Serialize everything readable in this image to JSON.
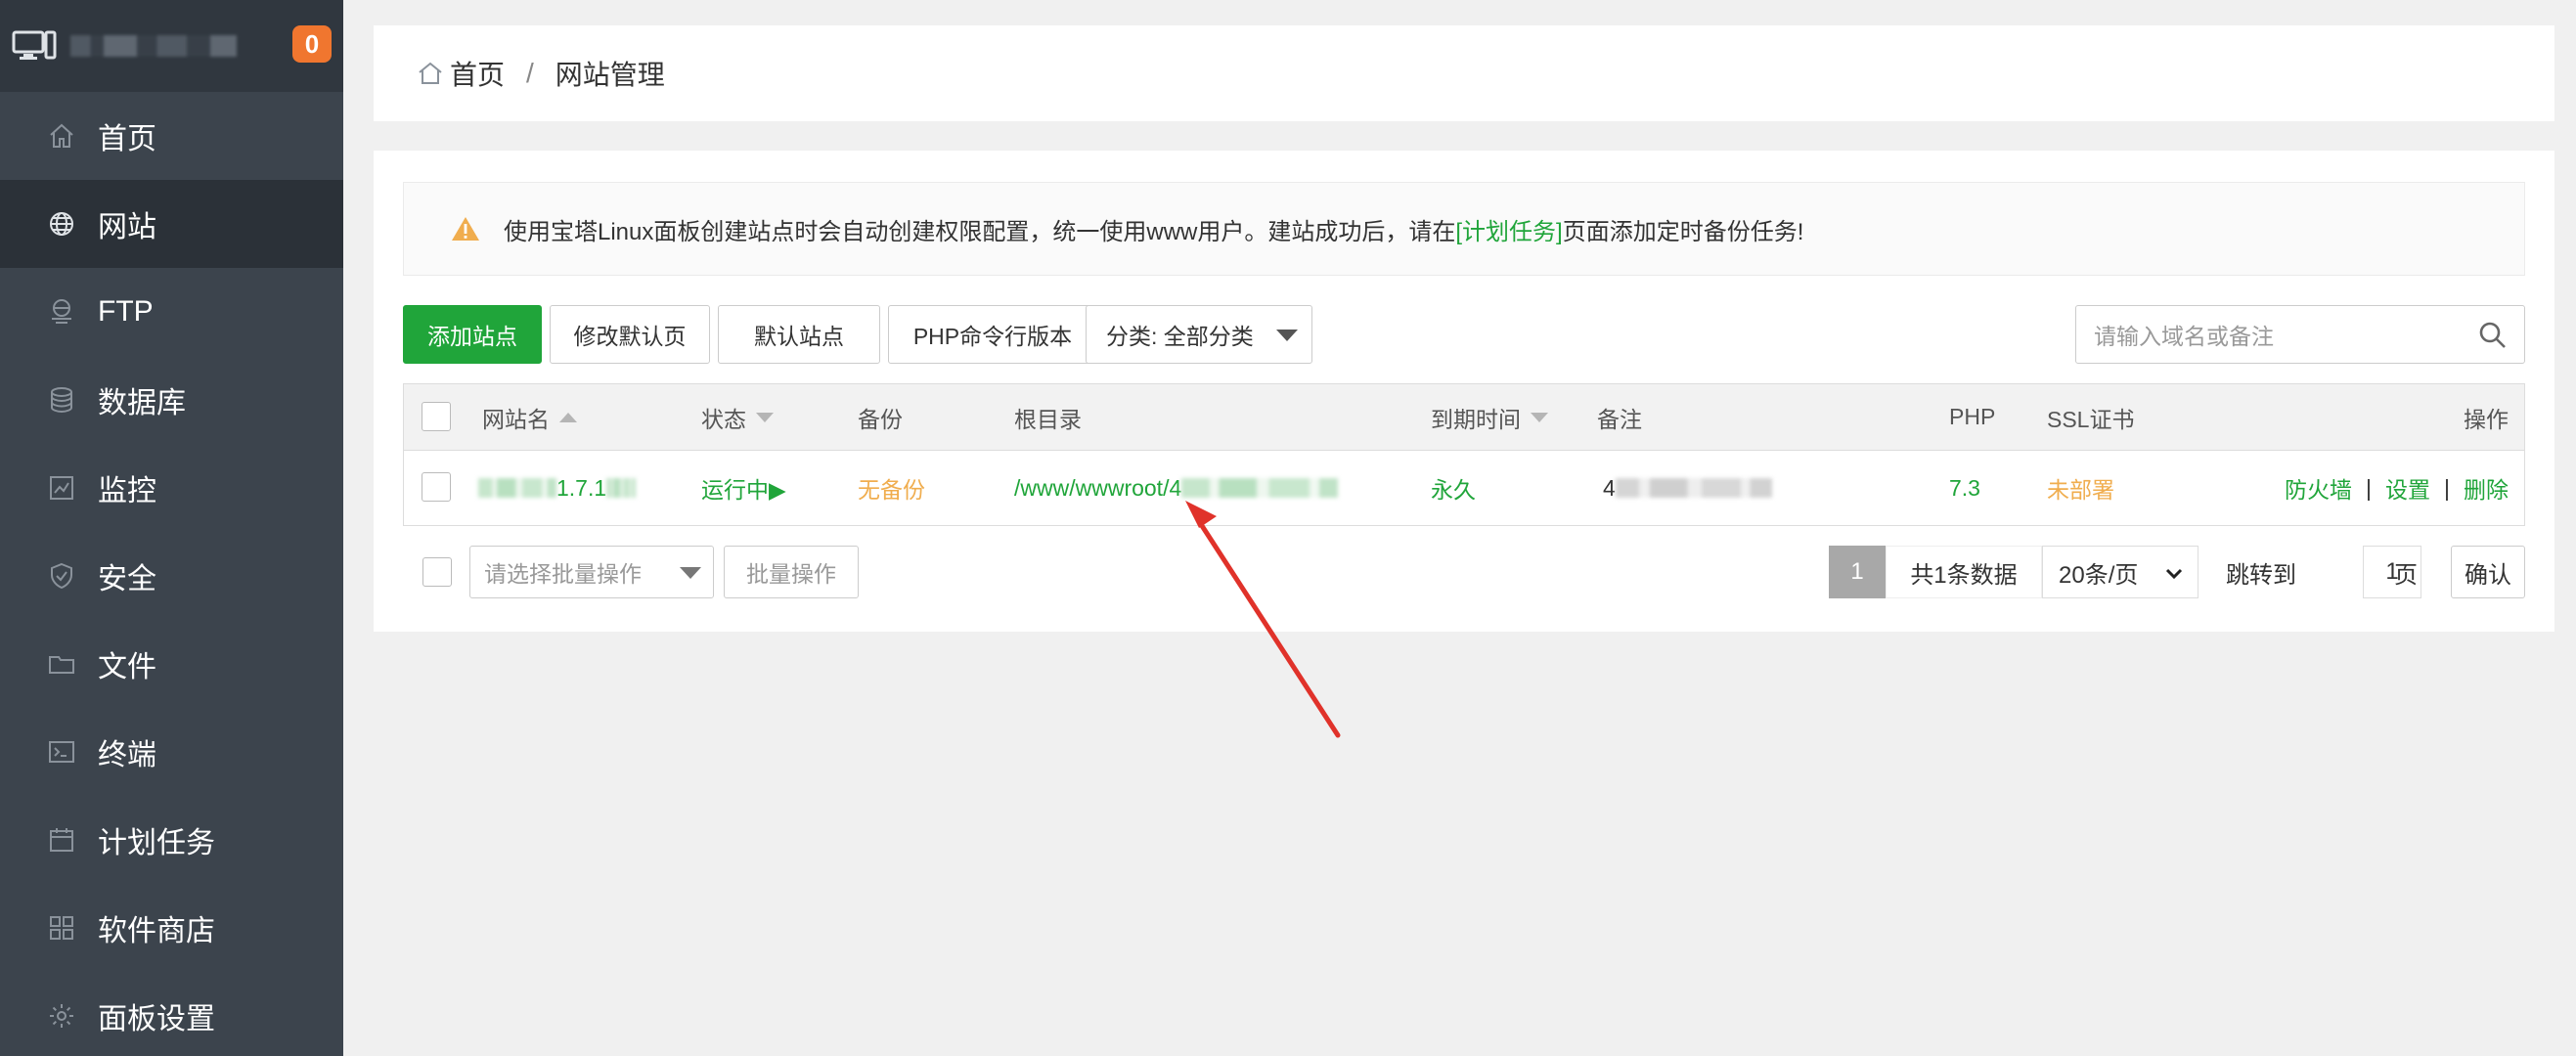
{
  "sidebar": {
    "server_badge": "0",
    "items": [
      {
        "label": "首页",
        "icon": "home-icon"
      },
      {
        "label": "网站",
        "icon": "globe-icon",
        "active": true
      },
      {
        "label": "FTP",
        "icon": "ftp-icon"
      },
      {
        "label": "数据库",
        "icon": "database-icon"
      },
      {
        "label": "监控",
        "icon": "monitor-chart-icon"
      },
      {
        "label": "安全",
        "icon": "shield-icon"
      },
      {
        "label": "文件",
        "icon": "folder-icon"
      },
      {
        "label": "终端",
        "icon": "terminal-icon"
      },
      {
        "label": "计划任务",
        "icon": "calendar-icon"
      },
      {
        "label": "软件商店",
        "icon": "grid-icon"
      },
      {
        "label": "面板设置",
        "icon": "gear-icon"
      }
    ]
  },
  "breadcrumb": {
    "home": "首页",
    "separator": "/",
    "current": "网站管理"
  },
  "notice": {
    "text_before": "使用宝塔Linux面板创建站点时会自动创建权限配置，统一使用www用户。建站成功后，请在",
    "link": "[计划任务]",
    "text_after": "页面添加定时备份任务!"
  },
  "toolbar": {
    "add_site": "添加站点",
    "edit_default_page": "修改默认页",
    "default_site": "默认站点",
    "php_cli": "PHP命令行版本",
    "category": "分类: 全部分类",
    "search_placeholder": "请输入域名或备注"
  },
  "table": {
    "headers": {
      "name": "网站名",
      "status": "状态",
      "backup": "备份",
      "root": "根目录",
      "expire": "到期时间",
      "remark": "备注",
      "php": "PHP",
      "ssl": "SSL证书",
      "ops": "操作"
    },
    "rows": [
      {
        "name_visible": "1.7.1",
        "status": "运行中▶",
        "backup": "无备份",
        "root_visible": "/www/wwwroot/4",
        "expire": "永久",
        "remark_visible": "4",
        "php": "7.3",
        "ssl": "未部署",
        "op_firewall": "防火墙",
        "op_settings": "设置",
        "op_delete": "删除",
        "op_sep": "|"
      }
    ]
  },
  "footer": {
    "batch_placeholder": "请选择批量操作",
    "batch_button": "批量操作",
    "current_page": "1",
    "total": "共1条数据",
    "page_size": "20条/页",
    "jump_label": "跳转到",
    "jump_value": "1",
    "page_unit": "页",
    "confirm": "确认"
  },
  "colors": {
    "accent": "#20a53a",
    "warning": "#f0ad4e",
    "sidebar_bg": "#3c444d",
    "badge": "#f0762f",
    "annotation_arrow": "#e0322a"
  }
}
